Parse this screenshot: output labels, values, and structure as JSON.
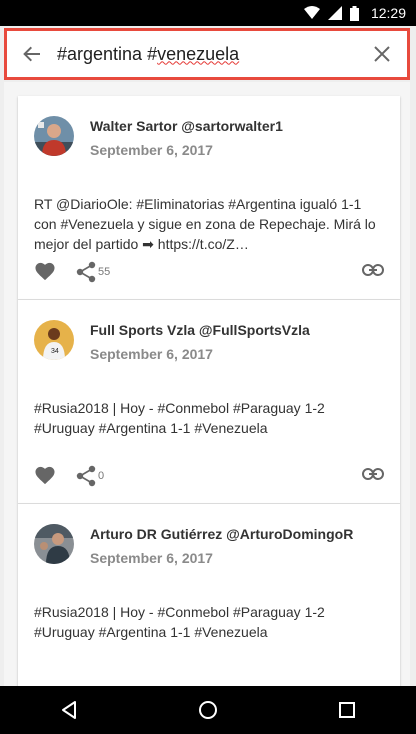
{
  "status_bar": {
    "time": "12:29",
    "icons": [
      "wifi-icon",
      "signal-icon",
      "battery-icon"
    ]
  },
  "search": {
    "query_part1": "#argentina #",
    "query_misspelled": "venezuela",
    "back_icon": "arrow-back-icon",
    "clear_icon": "close-icon",
    "border_color": "#e84a3d"
  },
  "tweets": [
    {
      "author": "Walter Sartor @sartorwalter1",
      "date": "September 6, 2017",
      "text": "RT @DiarioOle: #Eliminatorias #Argentina igualó 1-1 con #Venezuela y sigue en zona de Repechaje. Mirá lo mejor del partido ➡ https://t.co/Z…",
      "share_count": "55"
    },
    {
      "author": "Full Sports Vzla @FullSportsVzla",
      "date": "September 6, 2017",
      "text": "#Rusia2018 | Hoy - #Conmebol #Paraguay 1-2 #Uruguay #Argentina 1-1 #Venezuela",
      "share_count": "0"
    },
    {
      "author": "Arturo DR Gutiérrez @ArturoDomingoR",
      "date": "September 6, 2017",
      "text": "#Rusia2018 | Hoy - #Conmebol #Paraguay 1-2 #Uruguay #Argentina 1-1 #Venezuela",
      "share_count": ""
    }
  ],
  "nav_bar": {
    "icons": [
      "back-triangle-icon",
      "home-circle-icon",
      "recents-square-icon"
    ]
  }
}
